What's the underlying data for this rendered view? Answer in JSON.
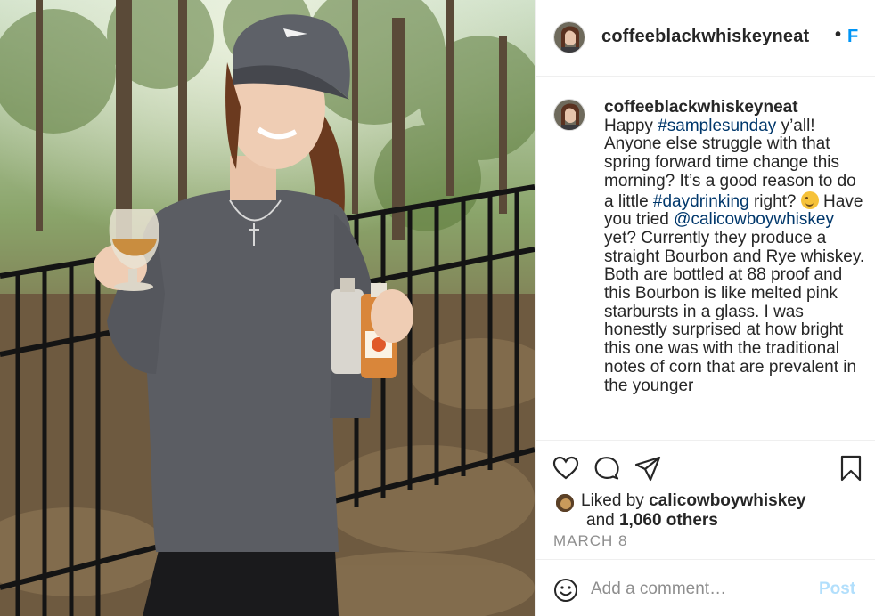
{
  "post": {
    "username": "coffeeblackwhiskeyneat",
    "header_separator": "•",
    "follow_label": "F",
    "caption": {
      "username": "coffeeblackwhiskeyneat",
      "segments": [
        {
          "text": "Happy ",
          "type": "text"
        },
        {
          "text": "#samplesunday",
          "type": "tag"
        },
        {
          "text": " y’all! Anyone else struggle with that spring forward time change this morning? It’s a good reason to do a little ",
          "type": "text"
        },
        {
          "text": "#daydrinking",
          "type": "tag"
        },
        {
          "text": " right? ",
          "type": "text"
        },
        {
          "text": "winking-face-emoji",
          "type": "emoji"
        },
        {
          "text": " Have you tried ",
          "type": "text"
        },
        {
          "text": "@calicowboywhiskey",
          "type": "tag"
        },
        {
          "text": " yet? Currently they produce a straight Bourbon and Rye whiskey. Both are bottled at 88 proof and this Bourbon is like melted pink starbursts in a glass. I was honestly surprised at how bright this one was with the traditional notes of corn that are prevalent in the younger",
          "type": "text"
        }
      ]
    },
    "actions": {
      "like_icon": "heart-icon",
      "comment_icon": "comment-bubble-icon",
      "share_icon": "paper-plane-icon",
      "save_icon": "bookmark-icon"
    },
    "likes": {
      "prefix": "Liked by",
      "liked_by_user": "calicowboywhiskey",
      "and_label": "and",
      "others": "1,060 others"
    },
    "date": "MARCH 8",
    "comment": {
      "placeholder": "Add a comment…",
      "post_label": "Post"
    }
  },
  "colors": {
    "link_blue": "#0095f6",
    "tag_blue": "#00376b",
    "muted": "#8e8e8e",
    "post_disabled": "#b2dffc"
  }
}
